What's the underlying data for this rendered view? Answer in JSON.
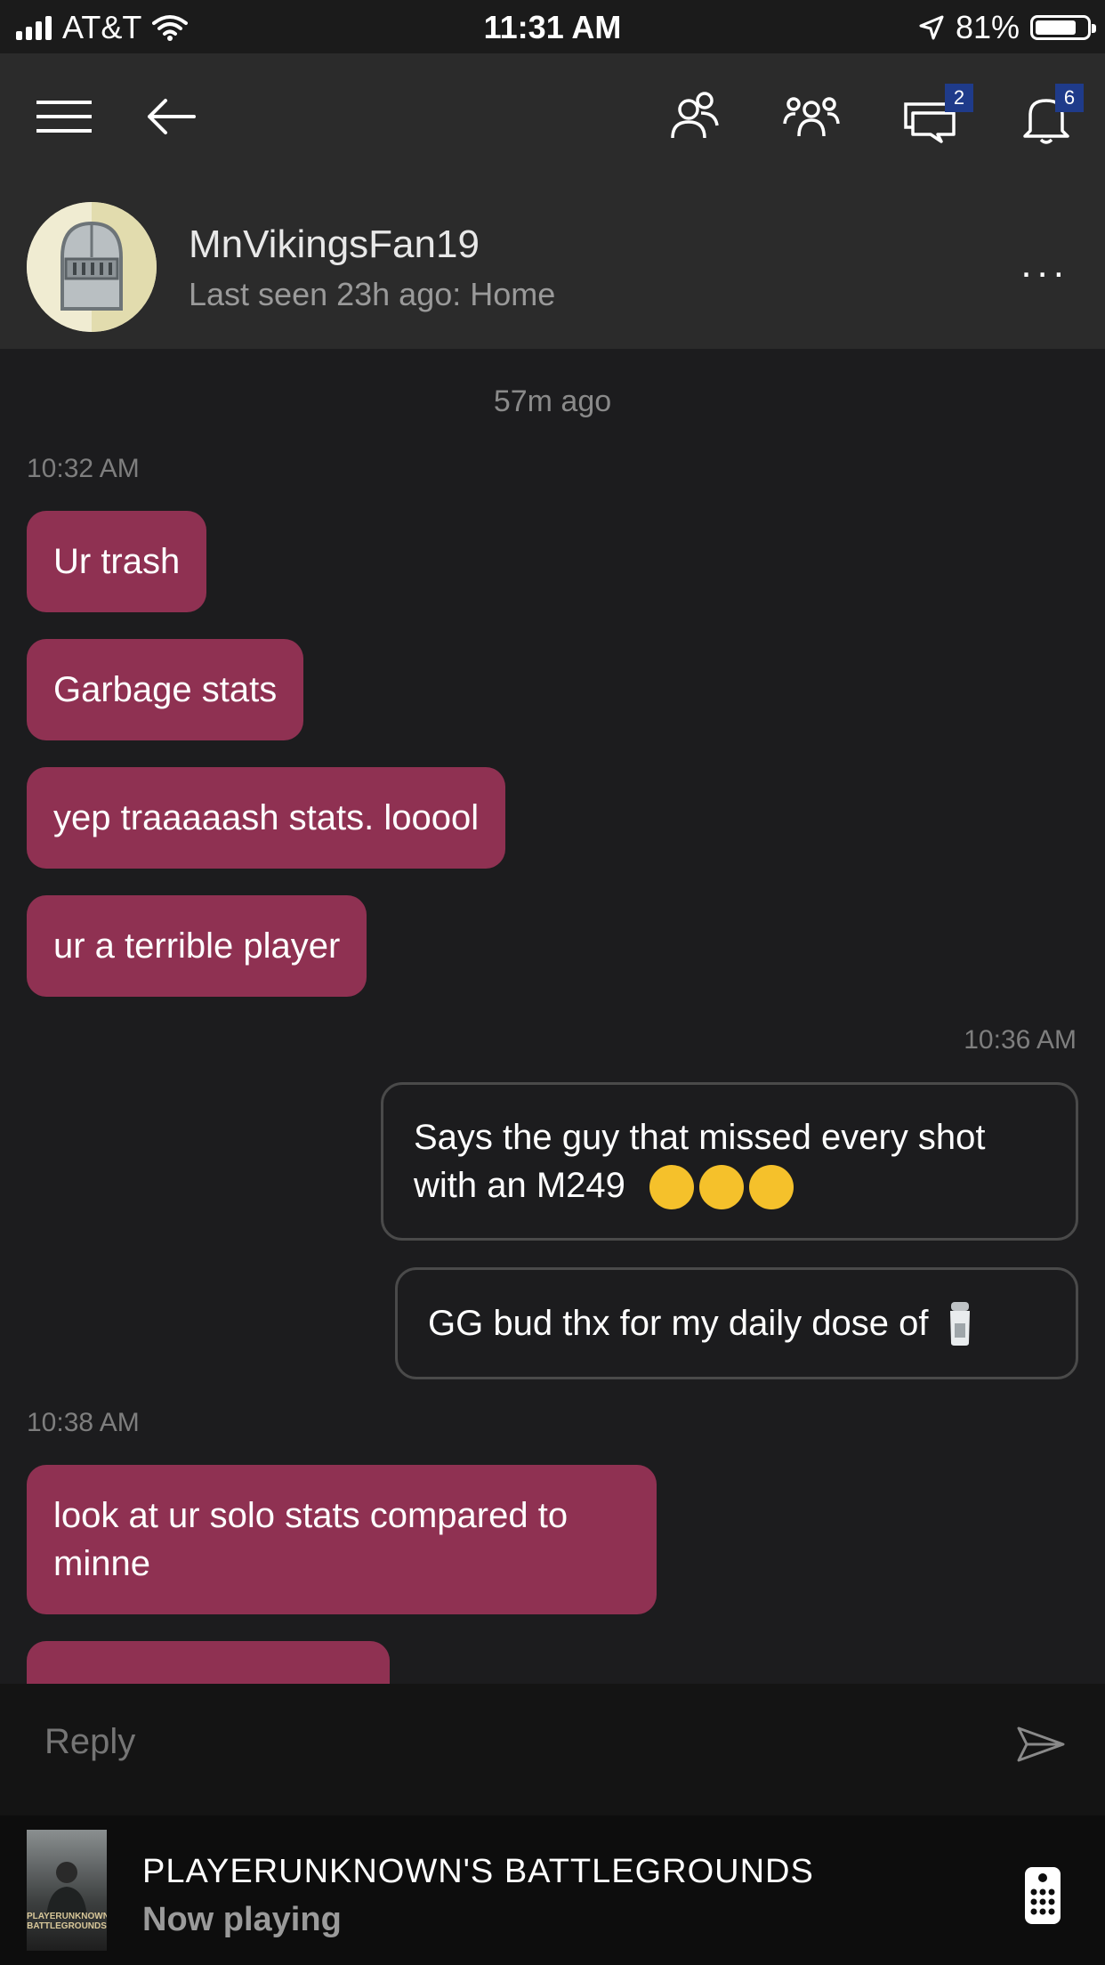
{
  "status_bar": {
    "carrier": "AT&T",
    "time": "11:31 AM",
    "battery_percent": "81%",
    "battery_level": 0.81
  },
  "toolbar": {
    "messages_badge": "2",
    "notifications_badge": "6"
  },
  "profile": {
    "username": "MnVikingsFan19",
    "last_seen": "Last seen 23h ago: Home",
    "more_label": "..."
  },
  "chat": {
    "relative_time": "57m ago",
    "timestamps": [
      "10:32 AM",
      "10:36 AM",
      "10:38 AM"
    ],
    "messages": [
      {
        "text": "Ur trash",
        "direction": "incoming"
      },
      {
        "text": "Garbage stats",
        "direction": "incoming"
      },
      {
        "text": "yep traaaaash stats. looool",
        "direction": "incoming"
      },
      {
        "text": "ur a terrible player",
        "direction": "incoming"
      },
      {
        "text": "Says the guy that missed every shot",
        "text_line2": "with an M249",
        "direction": "outgoing",
        "emoji": "laughing-crying-face-icon x3"
      },
      {
        "text": "GG bud thx for my daily dose of",
        "direction": "outgoing",
        "emoji": "salt-shaker-icon"
      },
      {
        "text": "look at ur solo stats compared to",
        "text_line2": "minne",
        "direction": "incoming"
      }
    ]
  },
  "reply": {
    "placeholder": "Reply"
  },
  "now_playing": {
    "game_title": "PLAYERUNKNOWN'S BATTLEGROUNDS",
    "status": "Now playing",
    "cover_text": "PLAYERUNKNOWN'S BATTLEGROUNDS"
  },
  "colors": {
    "incoming_bubble": "#8f3152",
    "outgoing_border": "#4a4a4a",
    "badge": "#1f3b8a",
    "background": "#1c1c1e"
  }
}
